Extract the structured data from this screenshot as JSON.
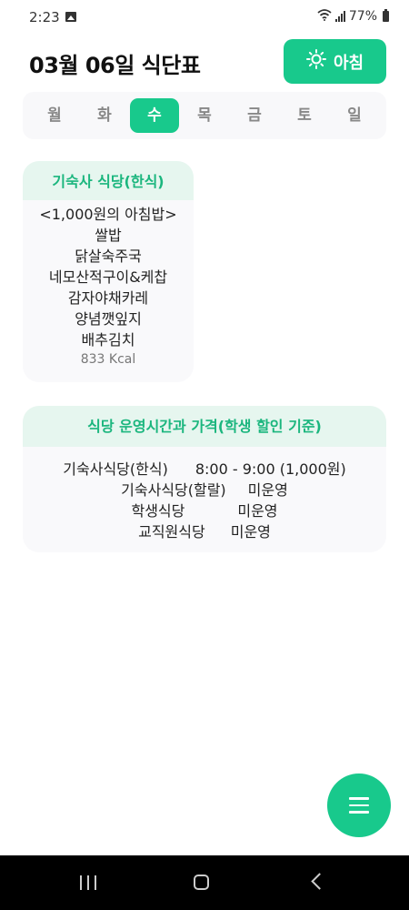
{
  "status_bar": {
    "time": "2:23",
    "battery": "77%"
  },
  "header": {
    "title": "03월 06일 식단표",
    "meal_button_label": "아침",
    "meal_icon": "sun-icon"
  },
  "weekdays": [
    "월",
    "화",
    "수",
    "목",
    "금",
    "토",
    "일"
  ],
  "selected_weekday": "수",
  "menu_card": {
    "title": "기숙사 식당(한식)",
    "items": [
      "<1,000원의 아침밥>",
      "쌀밥",
      "닭살숙주국",
      "네모산적구이&케찹",
      "감자야채카레",
      "양념깻잎지",
      "배추김치"
    ],
    "kcal": "833 Kcal"
  },
  "hours_card": {
    "title": "식당 운영시간과 가격(학생 할인 기준)",
    "rows": [
      {
        "name": "기숙사식당(한식)",
        "value": "8:00 - 9:00 (1,000원)"
      },
      {
        "name": "기숙사식당(할랄)",
        "value": "미운영"
      },
      {
        "name": "학생식당",
        "value": "미운영"
      },
      {
        "name": "교직원식당",
        "value": "미운영"
      }
    ]
  },
  "fab_icon": "menu-icon",
  "colors": {
    "accent": "#18c98c",
    "header_bg": "#e6f6ef",
    "header_text": "#1bb67e"
  }
}
